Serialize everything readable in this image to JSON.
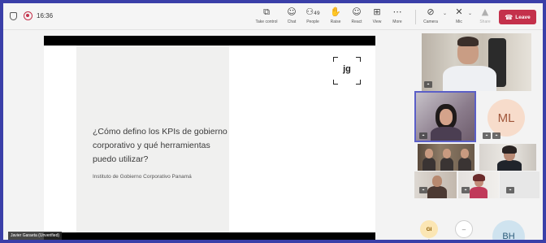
{
  "topbar": {
    "time": "16:36",
    "controls": [
      {
        "id": "take-control",
        "icon": "⧉",
        "label": "Take control"
      },
      {
        "id": "chat",
        "icon": "☺",
        "label": "Chat"
      },
      {
        "id": "people",
        "icon": "⚇",
        "label": "People",
        "count": "49"
      },
      {
        "id": "raise",
        "icon": "✋",
        "label": "Raise"
      },
      {
        "id": "react",
        "icon": "☺",
        "label": "React"
      },
      {
        "id": "view",
        "icon": "⊞",
        "label": "View"
      },
      {
        "id": "more",
        "icon": "⋯",
        "label": "More"
      }
    ],
    "camera": {
      "icon": "⊘",
      "label": "Camera"
    },
    "mic": {
      "icon": "✕",
      "label": "Mic"
    },
    "share": {
      "icon": "▲",
      "label": "Share"
    },
    "leave_label": "Leave",
    "leave_color": "#c4314b",
    "accent": "#5b5fc7"
  },
  "slide": {
    "logo_text": "jg",
    "title": "¿Cómo defino los KPIs de gobierno corporativo y qué herramientas puedo utilizar?",
    "subtitle": "Instituto de Gobierno Corporativo Panamá"
  },
  "presenter_name": "Javier Garaeta (Unverified)",
  "participants": {
    "ml_initials": "ML",
    "gi_initials": "GI",
    "dash_initials": "–",
    "bh_initials": "BH"
  }
}
